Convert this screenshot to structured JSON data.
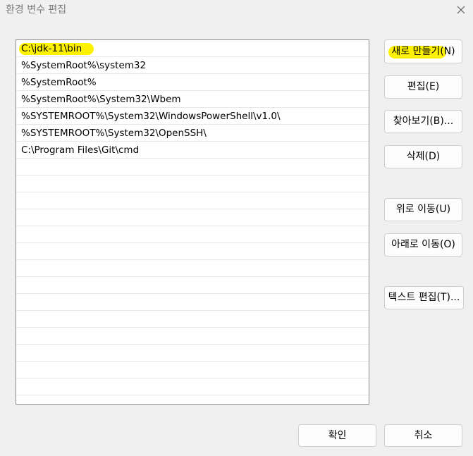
{
  "window": {
    "title": "환경 변수 편집",
    "close_icon": "close-icon"
  },
  "paths": [
    "C:\\jdk-11\\bin",
    "%SystemRoot%\\system32",
    "%SystemRoot%",
    "%SystemRoot%\\System32\\Wbem",
    "%SYSTEMROOT%\\System32\\WindowsPowerShell\\v1.0\\",
    "%SYSTEMROOT%\\System32\\OpenSSH\\",
    "C:\\Program Files\\Git\\cmd",
    "",
    "",
    "",
    "",
    "",
    "",
    "",
    "",
    "",
    "",
    "",
    "",
    "",
    "",
    ""
  ],
  "buttons": {
    "new": "새로 만들기(N)",
    "edit": "편집(E)",
    "browse": "찾아보기(B)...",
    "delete": "삭제(D)",
    "move_up": "위로 이동(U)",
    "move_down": "아래로 이동(O)",
    "edit_text": "텍스트 편집(T)...",
    "ok": "확인",
    "cancel": "취소"
  },
  "colors": {
    "highlight": "#fff200",
    "background": "#f0f0f0"
  }
}
